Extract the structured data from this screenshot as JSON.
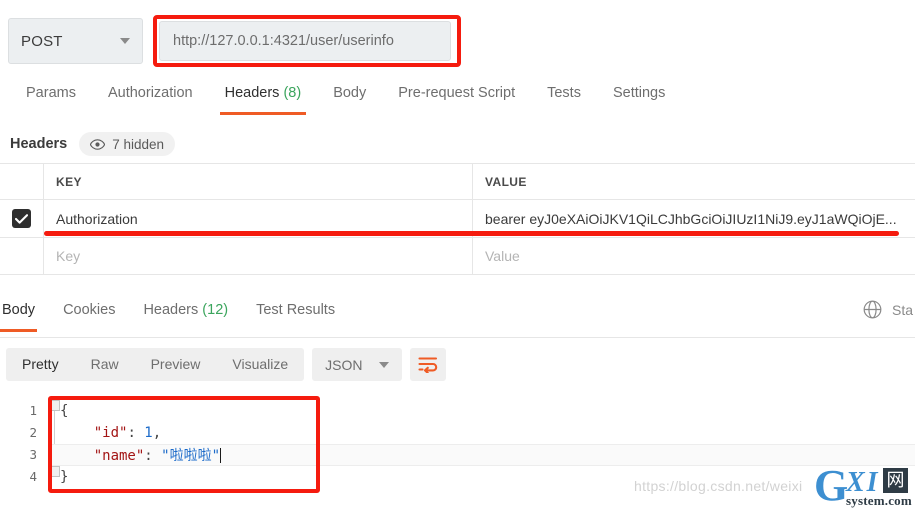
{
  "request": {
    "method": "POST",
    "method_icon": "chevron-down-icon",
    "url": "http://127.0.0.1:4321/user/userinfo",
    "tabs": [
      {
        "label": "Params",
        "count": "",
        "active": false
      },
      {
        "label": "Authorization",
        "count": "",
        "active": false
      },
      {
        "label": "Headers",
        "count": "(8)",
        "active": true
      },
      {
        "label": "Body",
        "count": "",
        "active": false
      },
      {
        "label": "Pre-request Script",
        "count": "",
        "active": false
      },
      {
        "label": "Tests",
        "count": "",
        "active": false
      },
      {
        "label": "Settings",
        "count": "",
        "active": false
      }
    ]
  },
  "headers_panel": {
    "title": "Headers",
    "hidden_pill": {
      "icon": "eye-icon",
      "label": "7 hidden"
    },
    "columns": {
      "key": "KEY",
      "value": "VALUE"
    },
    "rows": [
      {
        "checked": true,
        "key": "Authorization",
        "value": "bearer eyJ0eXAiOiJKV1QiLCJhbGciOiJIUzI1NiJ9.eyJ1aWQiOjE..."
      }
    ],
    "new_row": {
      "key_placeholder": "Key",
      "value_placeholder": "Value"
    }
  },
  "response": {
    "tabs": [
      {
        "label": "Body",
        "count": "",
        "active": true
      },
      {
        "label": "Cookies",
        "count": "",
        "active": false
      },
      {
        "label": "Headers",
        "count": "(12)",
        "active": false
      },
      {
        "label": "Test Results",
        "count": "",
        "active": false
      }
    ],
    "globe_icon": "globe-icon",
    "status_text": "Sta",
    "view_modes": [
      {
        "label": "Pretty",
        "active": true
      },
      {
        "label": "Raw",
        "active": false
      },
      {
        "label": "Preview",
        "active": false
      },
      {
        "label": "Visualize",
        "active": false
      }
    ],
    "format_select": {
      "value": "JSON",
      "icon": "chevron-down-icon"
    },
    "wrap_button": {
      "icon": "word-wrap-icon"
    },
    "body_lines": [
      {
        "n": "1",
        "segments": [
          {
            "t": "{",
            "c": "pb"
          }
        ]
      },
      {
        "n": "2",
        "segments": [
          {
            "t": "    ",
            "c": "pb"
          },
          {
            "t": "\"id\"",
            "c": "pk"
          },
          {
            "t": ": ",
            "c": "pb"
          },
          {
            "t": "1",
            "c": "pn"
          },
          {
            "t": ",",
            "c": "pb"
          }
        ]
      },
      {
        "n": "3",
        "segments": [
          {
            "t": "    ",
            "c": "pb"
          },
          {
            "t": "\"name\"",
            "c": "pk"
          },
          {
            "t": ": ",
            "c": "pb"
          },
          {
            "t": "\"啦啦啦\"",
            "c": "ps"
          }
        ]
      },
      {
        "n": "4",
        "segments": [
          {
            "t": "}",
            "c": "pb"
          }
        ]
      }
    ]
  },
  "annotations": {
    "url_box_color": "#f51b0e",
    "header_underline_color": "#f51b0e",
    "code_box_color": "#f51b0e"
  },
  "watermark": {
    "url": "https://blog.csdn.net/weixi",
    "logo_g": "G",
    "logo_xi": "XI",
    "logo_net": "网",
    "logo_sub": "system.com"
  },
  "colors": {
    "accent": "#ef5b25",
    "count": "#3ba55d",
    "annotation": "#f51b0e"
  }
}
